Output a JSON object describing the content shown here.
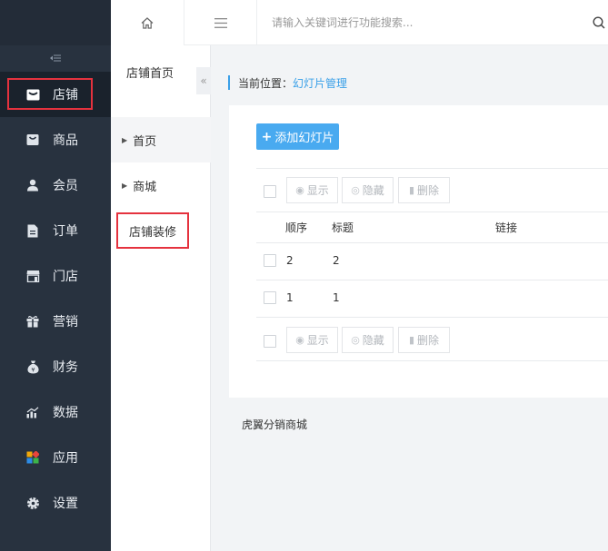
{
  "sidebar": {
    "collapse_icon": "collapse-icon",
    "items": [
      {
        "label": "店铺",
        "icon": "store-icon"
      },
      {
        "label": "商品",
        "icon": "goods-icon"
      },
      {
        "label": "会员",
        "icon": "user-icon"
      },
      {
        "label": "订单",
        "icon": "order-icon"
      },
      {
        "label": "门店",
        "icon": "shop-icon"
      },
      {
        "label": "营销",
        "icon": "gift-icon"
      },
      {
        "label": "财务",
        "icon": "money-icon"
      },
      {
        "label": "数据",
        "icon": "chart-icon"
      },
      {
        "label": "应用",
        "icon": "apps-icon"
      },
      {
        "label": "设置",
        "icon": "gear-icon"
      }
    ]
  },
  "submenu": {
    "title": "店铺首页",
    "items": [
      {
        "label": "首页"
      },
      {
        "label": "商城"
      },
      {
        "label": "店铺装修"
      }
    ]
  },
  "topbar": {
    "search_placeholder": "请输入关键词进行功能搜索..."
  },
  "breadcrumb": {
    "prefix": "当前位置：",
    "current": "幻灯片管理"
  },
  "panel": {
    "add_button": "添加幻灯片",
    "toolbar": {
      "show": "显示",
      "hide": "隐藏",
      "delete": "删除"
    },
    "columns": [
      "顺序",
      "标题",
      "链接"
    ],
    "rows": [
      {
        "order": "2",
        "title": "2",
        "link": ""
      },
      {
        "order": "1",
        "title": "1",
        "link": ""
      }
    ]
  },
  "footer": {
    "text": "虎翼分销商城"
  },
  "colors": {
    "sidebar_bg": "#28323f",
    "accent": "#3aa0e8",
    "highlight_frame": "#e5323e"
  }
}
